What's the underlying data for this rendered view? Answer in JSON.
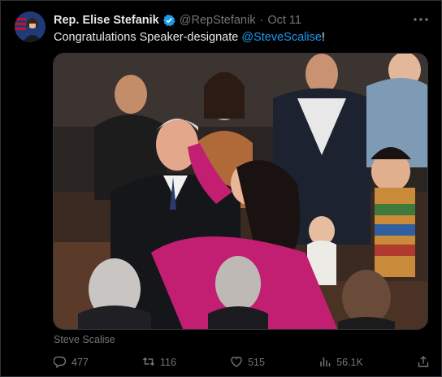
{
  "tweet": {
    "author_name": "Rep. Elise Stefanik",
    "handle": "@RepStefanik",
    "separator": "·",
    "date": "Oct 11",
    "text_prefix": "Congratulations Speaker-designate ",
    "mention": "@SteveScalise",
    "text_suffix": "!",
    "media_caption": "Steve Scalise"
  },
  "actions": {
    "replies": "477",
    "reposts": "116",
    "likes": "515",
    "views": "56.1K"
  },
  "icons": {
    "verified": "verified-badge-icon",
    "more": "more-dots-icon",
    "reply": "reply-icon",
    "repost": "repost-icon",
    "like": "heart-icon",
    "views": "views-chart-icon",
    "share": "share-icon"
  },
  "colors": {
    "background": "#000000",
    "text": "#e7e9ea",
    "muted": "#71767b",
    "accent": "#1d9bf0"
  }
}
